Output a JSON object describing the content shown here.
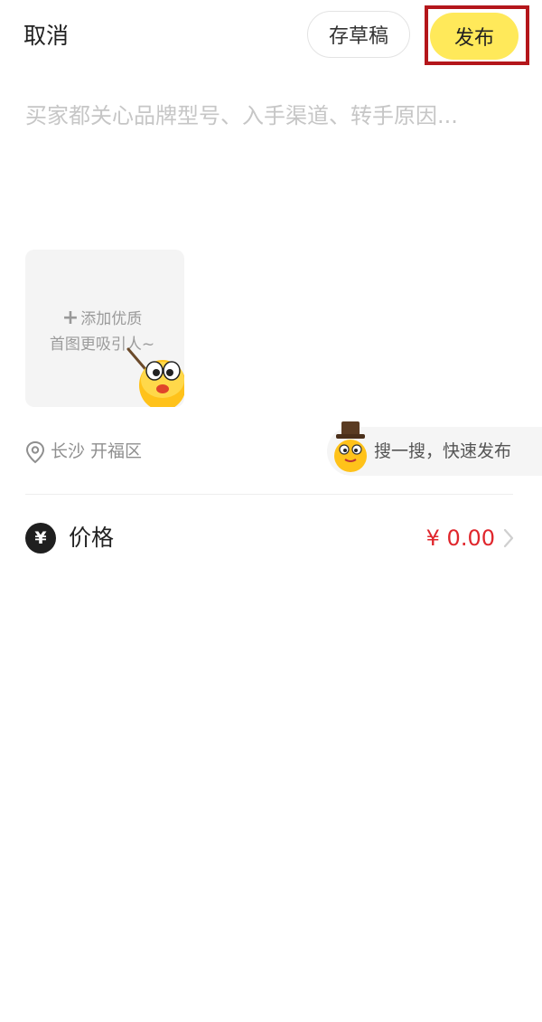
{
  "header": {
    "cancel_label": "取消",
    "draft_label": "存草稿",
    "publish_label": "发布"
  },
  "description": {
    "placeholder": "买家都关心品牌型号、入手渠道、转手原因..."
  },
  "image_upload": {
    "plus_symbol": "+",
    "line1": "添加优质",
    "line2": "首图更吸引人~"
  },
  "location": {
    "text": "长沙 开福区"
  },
  "search_chip": {
    "text": "搜一搜，快速发布"
  },
  "price": {
    "label": "价格",
    "currency_icon": "¥",
    "value": "¥ 0.00"
  },
  "colors": {
    "publish_bg": "#ffe95a",
    "highlight_border": "#b4161b",
    "price_red": "#e0262c"
  }
}
